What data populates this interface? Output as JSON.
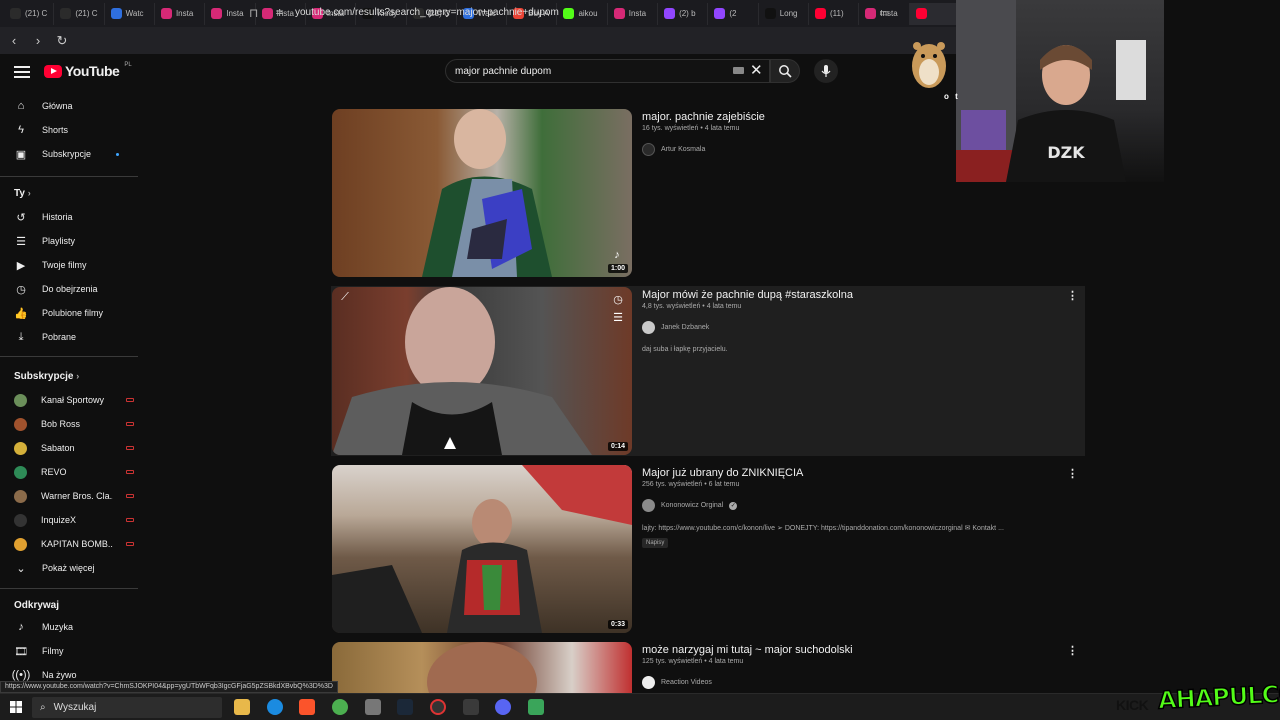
{
  "browser": {
    "tabs": [
      {
        "label": "(21) C",
        "icon": "x-icon",
        "color": "#2b2b2b"
      },
      {
        "label": "(21) C",
        "icon": "x-icon",
        "color": "#2b2b2b"
      },
      {
        "label": "Watc",
        "icon": "watch-icon",
        "color": "#2f6fde"
      },
      {
        "label": "Insta",
        "icon": "instagram-icon",
        "color": "#d62976"
      },
      {
        "label": "Insta",
        "icon": "instagram-icon",
        "color": "#d62976"
      },
      {
        "label": "Insta",
        "icon": "instagram-icon",
        "color": "#d62976"
      },
      {
        "label": "Insta",
        "icon": "instagram-icon",
        "color": "#d62976"
      },
      {
        "label": "Kiedy",
        "icon": "tiktok-icon",
        "color": "#111111"
      },
      {
        "label": "(21) C",
        "icon": "x-icon",
        "color": "#2b2b2b"
      },
      {
        "label": "Watc",
        "icon": "watch-icon",
        "color": "#2f6fde"
      },
      {
        "label": "Buy A",
        "icon": "google-icon",
        "color": "#ea4335"
      },
      {
        "label": "aikou",
        "icon": "kick-icon",
        "color": "#53fc18"
      },
      {
        "label": "Insta",
        "icon": "instagram-icon",
        "color": "#d62976"
      },
      {
        "label": "(2) b",
        "icon": "twitch-icon",
        "color": "#9146ff"
      },
      {
        "label": "(2",
        "icon": "twitch-icon",
        "color": "#9146ff"
      },
      {
        "label": "Long",
        "icon": "tiktok-icon",
        "color": "#111111"
      },
      {
        "label": "(11)",
        "icon": "youtube-icon",
        "color": "#ff0033"
      },
      {
        "label": "Insta",
        "icon": "instagram-icon",
        "color": "#d62976"
      },
      {
        "label": "",
        "icon": "youtube-icon",
        "color": "#ff0033"
      }
    ],
    "url": "youtube.com/results?search_query=major+pachnie+dupom",
    "status_url": "https://www.youtube.com/watch?v=ChmSJOKPI04&pp=ygUTbWFqb3IgcGFjaG5pZSBkdXBvbQ%3D%3D"
  },
  "youtube": {
    "logo_text": "YouTube",
    "country": "PL",
    "search_value": "major pachnie dupom",
    "sidebar": {
      "main": [
        {
          "label": "Główna",
          "icon": "home-icon"
        },
        {
          "label": "Shorts",
          "icon": "shorts-icon"
        },
        {
          "label": "Subskrypcje",
          "icon": "subscriptions-icon"
        }
      ],
      "you_heading": "Ty",
      "you": [
        {
          "label": "Historia",
          "icon": "history-icon"
        },
        {
          "label": "Playlisty",
          "icon": "playlists-icon"
        },
        {
          "label": "Twoje filmy",
          "icon": "your-videos-icon"
        },
        {
          "label": "Do obejrzenia",
          "icon": "watch-later-icon"
        },
        {
          "label": "Polubione filmy",
          "icon": "liked-icon"
        },
        {
          "label": "Pobrane",
          "icon": "download-icon"
        }
      ],
      "subs_heading": "Subskrypcje",
      "subs": [
        {
          "label": "Kanał Sportowy",
          "color": "#6b8f5a"
        },
        {
          "label": "Bob Ross",
          "color": "#a0522d"
        },
        {
          "label": "Sabaton",
          "color": "#d4b03a"
        },
        {
          "label": "REVO",
          "color": "#2e8b57"
        },
        {
          "label": "Warner Bros. Cla...",
          "color": "#8b6b4a"
        },
        {
          "label": "InquizeX",
          "color": "#333333"
        },
        {
          "label": "KAPITAN BOMB...",
          "color": "#e0a030"
        }
      ],
      "show_more": "Pokaż więcej",
      "explore_heading": "Odkrywaj",
      "explore": [
        {
          "label": "Muzyka",
          "icon": "music-icon"
        },
        {
          "label": "Filmy",
          "icon": "movies-icon"
        },
        {
          "label": "Na żywo",
          "icon": "live-icon"
        }
      ]
    },
    "results": [
      {
        "title": "major. pachnie zajebiście",
        "meta": "16 tys. wyświetleń • 4 lata temu",
        "channel": "Artur Kosmala",
        "duration": "1:00",
        "description": "",
        "badge": ""
      },
      {
        "title": "Major mówi że pachnie dupą #staraszkolna",
        "meta": "4,8 tys. wyświetleń • 4 lata temu",
        "channel": "Janek Dzbanek",
        "duration": "0:14",
        "description": "daj suba i łapkę przyjacielu.",
        "badge": ""
      },
      {
        "title": "Major już ubrany do ZNIKNIĘCIA",
        "meta": "256 tys. wyświetleń • 6 lat temu",
        "channel": "Kononowicz Orginal",
        "duration": "0:33",
        "description": "lajty: https://www.youtube.com/c/konon/live ➢ DONEJTY: https://tipanddonation.com/kononowiczorginal ✉ Kontakt ...",
        "badge": "Napisy"
      },
      {
        "title": "może narzygaj mi tutaj ~ major suchodolski",
        "meta": "125 tys. wyświetleń • 4 lata temu",
        "channel": "Reaction Videos",
        "duration": "",
        "description": "",
        "badge": ""
      }
    ]
  },
  "overlay": {
    "webcam_shirt": "DZK",
    "sticker_text": "o t",
    "kick_label": "KICK",
    "streamer_logo": "AHAPULCO"
  },
  "taskbar": {
    "search_label": "Wyszukaj"
  }
}
